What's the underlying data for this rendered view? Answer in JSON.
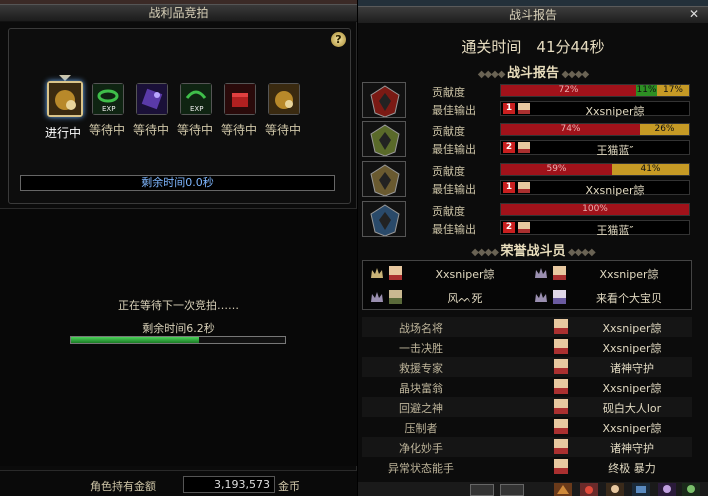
{
  "auction": {
    "title": "战利品竞拍",
    "help": "?",
    "slots": [
      {
        "label": "进行中",
        "icon": "treasure-bag-icon",
        "color": "#b8892a",
        "active": true
      },
      {
        "label": "等待中",
        "icon": "exp-ring-icon",
        "color": "#2e7d3a",
        "active": false
      },
      {
        "label": "等待中",
        "icon": "purple-crystal-icon",
        "color": "#5a3aa8",
        "active": false
      },
      {
        "label": "等待中",
        "icon": "exp-ring-icon",
        "color": "#2e7d3a",
        "active": false
      },
      {
        "label": "等待中",
        "icon": "red-box-icon",
        "color": "#b02020",
        "active": false
      },
      {
        "label": "等待中",
        "icon": "treasure-bag-icon",
        "color": "#b8892a",
        "active": false
      }
    ],
    "remaining_time": "剩余时间0.0秒",
    "waiting_text": "正在等待下一次竞拍……",
    "next_remaining_time": "剩余时间6.2秒",
    "next_progress": 0.6,
    "gold_label": "角色持有金额",
    "gold_value": "3,193,573",
    "gold_unit": "金币"
  },
  "report": {
    "title": "战斗报告",
    "close": "✕",
    "clear_time": "通关时间　41分44秒",
    "section_battle": "战斗报告",
    "contribution_label": "贡献度",
    "best_output_label": "最佳输出",
    "players": [
      {
        "portrait_color": "#7a1a14",
        "segments": [
          {
            "pct": 72,
            "label": "72%",
            "kind": "red"
          },
          {
            "pct": 11,
            "label": "11%",
            "kind": "green"
          },
          {
            "pct": 17,
            "label": "17%",
            "kind": "gold"
          }
        ],
        "best_icon": "1",
        "best_name": "Xxsniper諒"
      },
      {
        "portrait_color": "#5a6a2a",
        "segments": [
          {
            "pct": 74,
            "label": "74%",
            "kind": "red"
          },
          {
            "pct": 26,
            "label": "26%",
            "kind": "gold"
          }
        ],
        "best_icon": "2",
        "best_name": "王猫蓝″"
      },
      {
        "portrait_color": "#6a5a30",
        "segments": [
          {
            "pct": 59,
            "label": "59%",
            "kind": "red"
          },
          {
            "pct": 41,
            "label": "41%",
            "kind": "gold"
          }
        ],
        "best_icon": "1",
        "best_name": "Xxsniper諒"
      },
      {
        "portrait_color": "#2a4a6a",
        "segments": [
          {
            "pct": 100,
            "label": "100%",
            "kind": "red"
          }
        ],
        "best_icon": "2",
        "best_name": "王猫蓝″"
      }
    ],
    "section_honor": "荣誉战斗员",
    "honor": [
      {
        "name": "Xxsniper諒"
      },
      {
        "name": "Xxsniper諒"
      },
      {
        "name": "风ᨓ死"
      },
      {
        "name": "来看个大宝贝"
      }
    ],
    "titles": [
      {
        "label": "战场名将",
        "name": "Xxsniper諒"
      },
      {
        "label": "一击决胜",
        "name": "Xxsniper諒"
      },
      {
        "label": "救援专家",
        "name": "诸神守护"
      },
      {
        "label": "晶块富翁",
        "name": "Xxsniper諒"
      },
      {
        "label": "回避之神",
        "name": "砚白大人lor"
      },
      {
        "label": "压制者",
        "name": "Xxsniper諒"
      },
      {
        "label": "净化妙手",
        "name": "诸神守护"
      },
      {
        "label": "异常状态能手",
        "name": "终极 暴力"
      }
    ]
  }
}
